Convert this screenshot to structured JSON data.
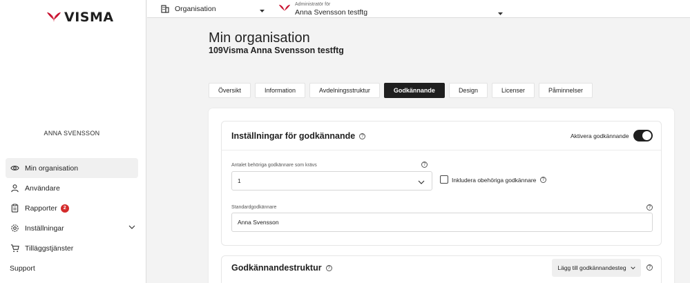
{
  "brand": {
    "name": "VISMA",
    "color": "#c8102e"
  },
  "topbar": {
    "org_label": "Organisation",
    "admin_small": "Administratör för",
    "admin_value": "Anna Svensson testftg"
  },
  "sidebar": {
    "user_name": "ANNA SVENSSON",
    "items": [
      {
        "label": "Min organisation",
        "icon": "eye-icon"
      },
      {
        "label": "Användare",
        "icon": "users-icon"
      },
      {
        "label": "Rapporter",
        "icon": "clipboard-icon",
        "badge": "2"
      },
      {
        "label": "Inställningar",
        "icon": "gear-icon"
      },
      {
        "label": "Tilläggstjänster",
        "icon": "cart-icon"
      }
    ],
    "support": "Support"
  },
  "page": {
    "title": "Min organisation",
    "subtitle": "109Visma Anna Svensson testftg"
  },
  "tabs": [
    {
      "label": "Översikt"
    },
    {
      "label": "Information"
    },
    {
      "label": "Avdelningsstruktur"
    },
    {
      "label": "Godkännande",
      "active": true
    },
    {
      "label": "Design"
    },
    {
      "label": "Licenser"
    },
    {
      "label": "Påminnelser"
    }
  ],
  "settings_card": {
    "title": "Inställningar för godkännande",
    "toggle_label": "Aktivera godkännande",
    "toggle_on": true,
    "count_label": "Antalet behöriga godkännare som krävs",
    "count_value": "1",
    "include_label": "Inkludera obehöriga godkännare",
    "include_checked": false,
    "default_label": "Standardgodkännare",
    "default_value": "Anna Svensson"
  },
  "structure_card": {
    "title": "Godkännandestruktur",
    "add_button": "Lägg till godkännandesteg"
  }
}
